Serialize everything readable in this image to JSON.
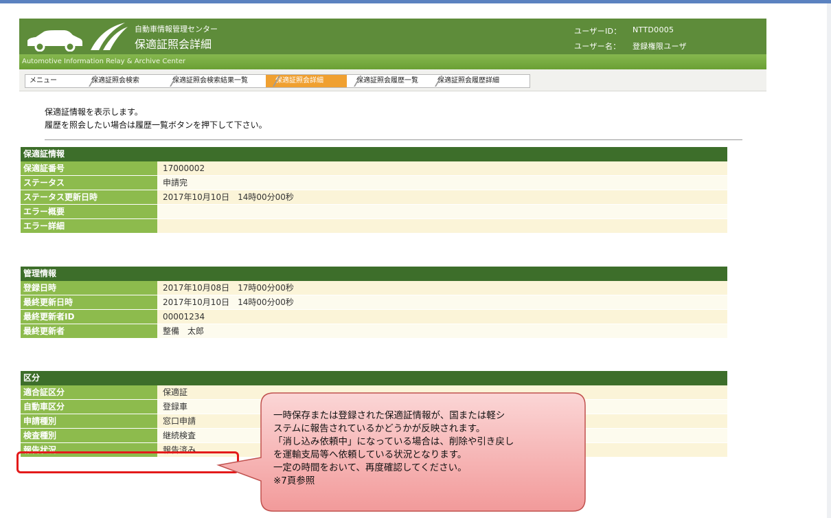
{
  "header": {
    "org_name": "自動車情報管理センター",
    "page_title": "保適証照会詳細",
    "org_english": "Automotive Information Relay & Archive Center",
    "user_id_label": "ユーザーID：",
    "user_id": "NTTD0005",
    "user_name_label": "ユーザー名：",
    "user_name": "登録権限ユーザ"
  },
  "breadcrumbs": [
    {
      "label": "メニュー",
      "active": false
    },
    {
      "label": "保適証照会検索",
      "active": false
    },
    {
      "label": "保適証照会検索結果一覧",
      "active": false
    },
    {
      "label": "保適証照会詳細",
      "active": true
    },
    {
      "label": "保適証照会履歴一覧",
      "active": false
    },
    {
      "label": "保適証照会履歴詳細",
      "active": false
    }
  ],
  "intro": {
    "line1": "保適証情報を表示します。",
    "line2": "履歴を照会したい場合は履歴一覧ボタンを押下して下さい。"
  },
  "sections": {
    "cert": {
      "title": "保適証情報",
      "rows": [
        {
          "label": "保適証番号",
          "value": "17000002"
        },
        {
          "label": "ステータス",
          "value": "申請完"
        },
        {
          "label": "ステータス更新日時",
          "value": "2017年10月10日　14時00分00秒"
        },
        {
          "label": "エラー概要",
          "value": ""
        },
        {
          "label": "エラー詳細",
          "value": ""
        }
      ]
    },
    "admin": {
      "title": "管理情報",
      "rows": [
        {
          "label": "登録日時",
          "value": "2017年10月08日　17時00分00秒"
        },
        {
          "label": "最終更新日時",
          "value": "2017年10月10日　14時00分00秒"
        },
        {
          "label": "最終更新者ID",
          "value": "00001234"
        },
        {
          "label": "最終更新者",
          "value": "整備　太郎"
        }
      ]
    },
    "category": {
      "title": "区分",
      "rows": [
        {
          "label": "適合証区分",
          "value": "保適証"
        },
        {
          "label": "自動車区分",
          "value": "登録車"
        },
        {
          "label": "申請種別",
          "value": "窓口申請"
        },
        {
          "label": "検査種別",
          "value": "継続検査"
        },
        {
          "label": "報告状況",
          "value": "報告済み"
        }
      ]
    }
  },
  "callout": {
    "line1": "一時保存または登録された保適証情報が、国または軽シ",
    "line2": "ステムに報告されているかどうかが反映されます。",
    "line3": "「消し込み依頼中」になっている場合は、削除や引き戻し",
    "line4": "を運輸支局等へ依頼している状況となります。",
    "line5": "一定の時間をおいて、再度確認してください。",
    "line6": "※7頁参照"
  },
  "colors": {
    "header_bg": "#5e8c3a",
    "label_bg": "#8dbb4d",
    "section_title_bg": "#3d6e2a",
    "active_crumb": "#f0a030",
    "highlight_border": "#e31a1a",
    "callout_fill": "#f7b3b3"
  }
}
